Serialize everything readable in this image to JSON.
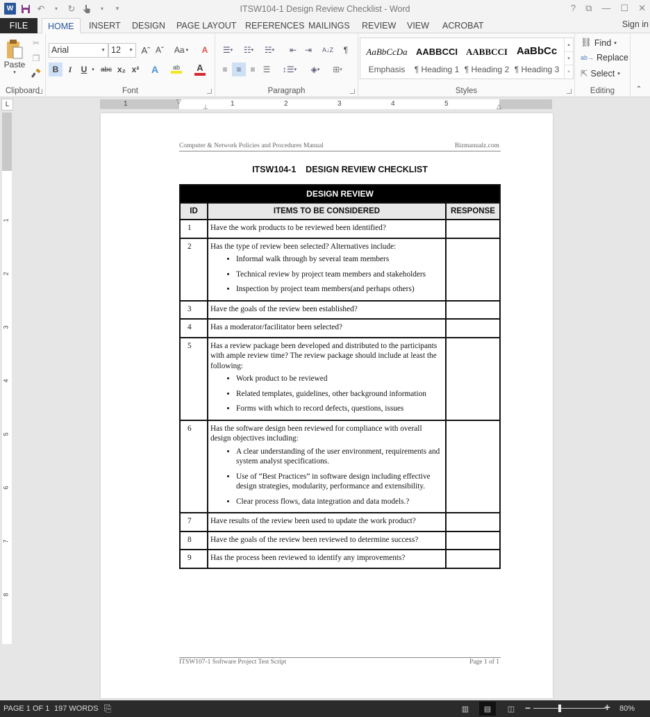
{
  "window": {
    "title": "ITSW104-1 Design Review Checklist - Word",
    "app_icon": "W",
    "controls": {
      "help": "?",
      "ribbon_display": "⧉",
      "minimize": "—",
      "maximize": "☐",
      "close": "✕"
    }
  },
  "qat": {
    "save": "save-icon",
    "undo": "↶",
    "redo": "↻",
    "touch": "touch-mode-icon",
    "customize": "▾"
  },
  "tabs": {
    "file": "FILE",
    "items": [
      "HOME",
      "INSERT",
      "DESIGN",
      "PAGE LAYOUT",
      "REFERENCES",
      "MAILINGS",
      "REVIEW",
      "VIEW",
      "ACROBAT"
    ],
    "active": "HOME",
    "sign_in": "Sign in"
  },
  "ribbon": {
    "clipboard": {
      "label": "Clipboard",
      "paste": "Paste"
    },
    "font": {
      "label": "Font",
      "font_name": "Arial",
      "font_size": "12",
      "grow": "Aˆ",
      "shrink": "Aˇ",
      "change_case": "Aa",
      "bold": "B",
      "italic": "I",
      "underline": "U",
      "strike": "abc",
      "subscript": "x₂",
      "superscript": "x²",
      "text_effects": "A",
      "highlight": "ab",
      "font_color": "A",
      "highlight_color": "#f5e625",
      "font_color_value": "#d9272e"
    },
    "paragraph": {
      "label": "Paragraph",
      "pilcrow": "¶",
      "sort": "A↓Z"
    },
    "styles": {
      "label": "Styles",
      "items": [
        {
          "sample": "AaBbCcDa",
          "name": "Emphasis"
        },
        {
          "sample": "AABBCCI",
          "name": "¶ Heading 1"
        },
        {
          "sample": "AABBCCI",
          "name": "¶ Heading 2"
        },
        {
          "sample": "AaBbCc",
          "name": "¶ Heading 3"
        }
      ]
    },
    "editing": {
      "label": "Editing",
      "find": "Find",
      "replace": "Replace",
      "select": "Select"
    }
  },
  "ruler": {
    "tab_selector": "L",
    "h_numbers": [
      "1",
      "1",
      "2",
      "3",
      "4",
      "5"
    ],
    "v_numbers": [
      "1",
      "2",
      "3",
      "4",
      "5",
      "6",
      "7",
      "8"
    ]
  },
  "document": {
    "header_left": "Computer & Network Policies and Procedures Manual",
    "header_right": "Bizmanualz.com",
    "title": "ITSW104-1    DESIGN REVIEW CHECKLIST",
    "table": {
      "banner": "DESIGN REVIEW",
      "columns": [
        "ID",
        "ITEMS TO BE CONSIDERED",
        "RESPONSE"
      ],
      "rows": [
        {
          "id": "1",
          "text": "Have the work products to be reviewed been identified?",
          "bullets": [],
          "response": ""
        },
        {
          "id": "2",
          "text": "Has the type of review been selected? Alternatives include:",
          "bullets": [
            "Informal walk through by several team members",
            "Technical review by project team members and stakeholders",
            "Inspection by project team members(and perhaps others)"
          ],
          "response": ""
        },
        {
          "id": "3",
          "text": "Have the goals of the review been established?",
          "bullets": [],
          "response": ""
        },
        {
          "id": "4",
          "text": "Has a moderator/facilitator been selected?",
          "bullets": [],
          "response": ""
        },
        {
          "id": "5",
          "text": "Has a review package been developed and distributed to the participants with ample review time? The review package should include at least the following:",
          "bullets": [
            "Work product to be reviewed",
            "Related templates, guidelines, other background information",
            "Forms with which to record defects, questions, issues"
          ],
          "response": ""
        },
        {
          "id": "6",
          "text": "Has the software design been reviewed for compliance with overall design objectives including:",
          "bullets": [
            "A clear understanding of the user environment, requirements and system analyst specifications.",
            "Use of “Best Practices” in software design including effective design strategies, modularity, performance and extensibility.",
            "Clear process flows, data integration and data models.?"
          ],
          "response": ""
        },
        {
          "id": "7",
          "text": "Have results of the review been used to update the work product?",
          "bullets": [],
          "response": ""
        },
        {
          "id": "8",
          "text": "Have the goals of the review been reviewed to determine success?",
          "bullets": [],
          "response": ""
        },
        {
          "id": "9",
          "text": "Has the process been reviewed to identify any improvements?",
          "bullets": [],
          "response": ""
        }
      ]
    },
    "footer_left": "ITSW107-1 Software Project Test Script",
    "footer_right": "Page 1 of 1"
  },
  "statusbar": {
    "page": "PAGE 1 OF 1",
    "words": "197 WORDS",
    "zoom_minus": "−",
    "zoom_plus": "+",
    "zoom_level": "80%",
    "zoom_percent": 80
  }
}
